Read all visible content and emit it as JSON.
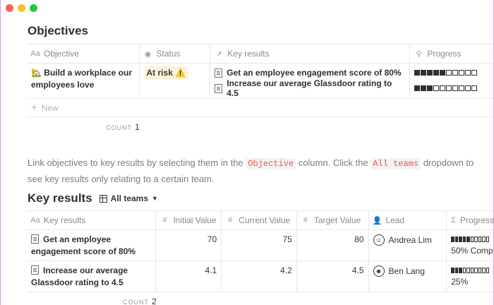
{
  "window": {
    "controls": [
      "close",
      "minimize",
      "maximize"
    ]
  },
  "objectives": {
    "title": "Objectives",
    "columns": [
      {
        "icon": "text-property-icon",
        "label": "Objective"
      },
      {
        "icon": "status-icon",
        "label": "Status"
      },
      {
        "icon": "relation-arrow-icon",
        "label": "Key results"
      },
      {
        "icon": "rollup-search-icon",
        "label": "Progress"
      }
    ],
    "rows": [
      {
        "emoji": "🏡",
        "objective": "Build a workplace our employees love",
        "status": "At risk ⚠️",
        "key_results": [
          "Get an employee engagement score of 80%",
          "Increase our average Glassdoor rating to 4.5"
        ],
        "progress": [
          {
            "filled": 5,
            "total": 10
          },
          {
            "filled": 3,
            "total": 10
          }
        ]
      }
    ],
    "new_label": "New",
    "count_label": "COUNT",
    "count_value": "1"
  },
  "note": {
    "text_1": "Link objectives to key results by selecting them in the ",
    "code_1": "Objective",
    "text_2": " column. Click the ",
    "code_2": "All teams",
    "text_3": " dropdown to see key results only relating to a certain team."
  },
  "key_results": {
    "title": "Key results",
    "view_label": "All teams",
    "columns": [
      {
        "icon": "text-property-icon",
        "label": "Key results"
      },
      {
        "icon": "number-icon",
        "label": "Initial Value"
      },
      {
        "icon": "number-icon",
        "label": "Current Value"
      },
      {
        "icon": "number-icon",
        "label": "Target Value"
      },
      {
        "icon": "person-icon",
        "label": "Lead"
      },
      {
        "icon": "formula-sigma-icon",
        "label": "Progress"
      }
    ],
    "rows": [
      {
        "name": "Get an employee engagement score of 80%",
        "initial": "70",
        "current": "75",
        "target": "80",
        "lead": "Andrea Lim",
        "progress_filled": 5,
        "progress_total": 10,
        "progress_text": "50% Compl"
      },
      {
        "name": "Increase our average Glassdoor rating to 4.5",
        "initial": "4.1",
        "current": "4.2",
        "target": "4.5",
        "lead": "Ben Lang",
        "progress_filled": 3,
        "progress_total": 10,
        "progress_text": "25%"
      }
    ],
    "count_label": "COUNT",
    "count_value": "2"
  }
}
